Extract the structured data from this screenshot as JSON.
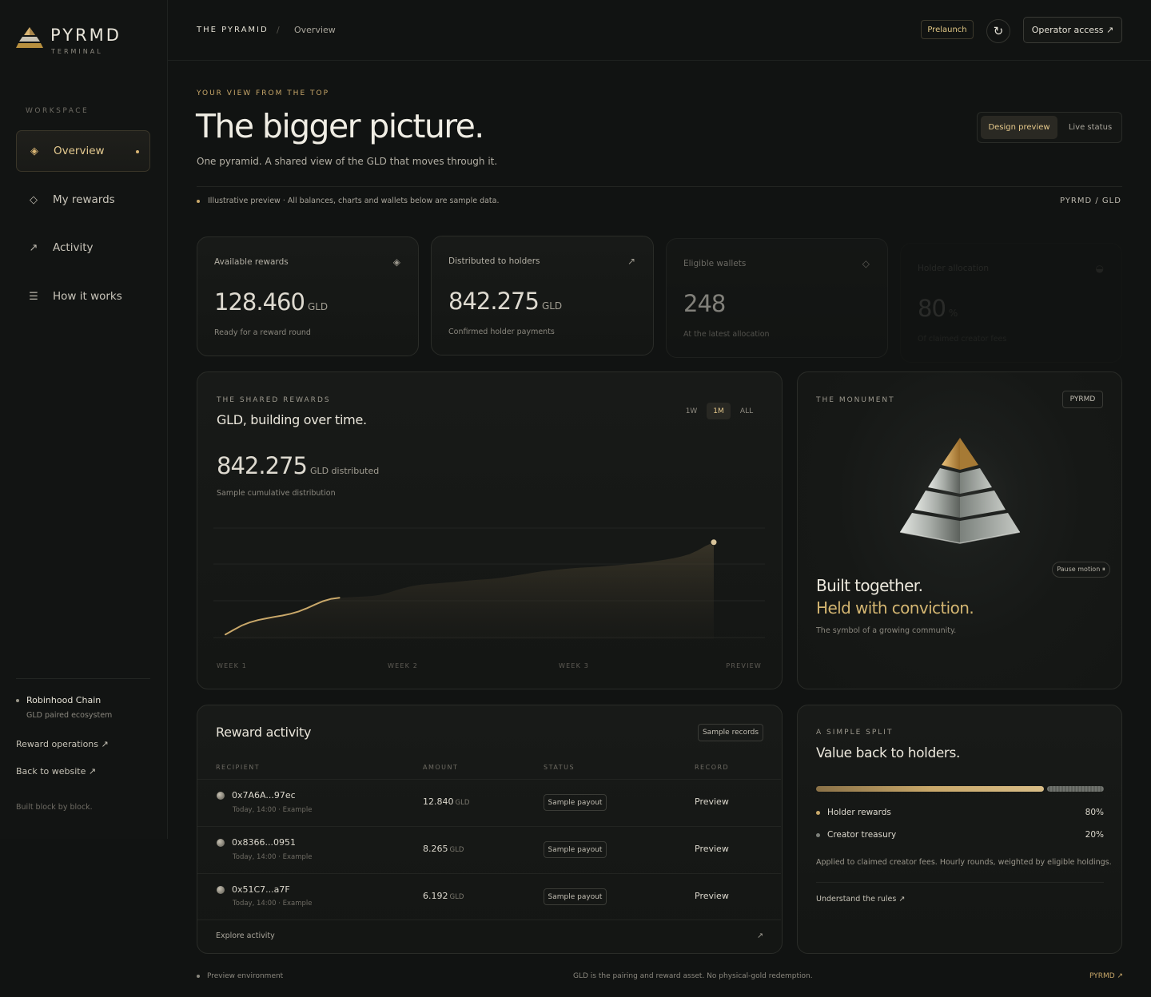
{
  "brand": {
    "name": "PYRMD",
    "sub": "TERMINAL"
  },
  "sidebar": {
    "section_label": "WORKSPACE",
    "items": [
      {
        "label": "Overview",
        "icon": "diamond-icon",
        "active": true
      },
      {
        "label": "My rewards",
        "icon": "diamond-outline-icon"
      },
      {
        "label": "Activity",
        "icon": "arrow-up-right-icon"
      },
      {
        "label": "How it works",
        "icon": "menu-lines-icon"
      }
    ],
    "chain": {
      "name": "Robinhood Chain",
      "sub": "GLD paired ecosystem"
    },
    "links": [
      "Reward operations ↗",
      "Back to website ↗"
    ],
    "footer": "Built block by block."
  },
  "topbar": {
    "crumb_1": "THE PYRAMID",
    "crumb_sep": "/",
    "crumb_2": "Overview",
    "prelaunch": "Prelaunch",
    "refresh_icon": "↻",
    "operator": "Operator access ↗"
  },
  "hero": {
    "eyebrow": "YOUR VIEW FROM THE TOP",
    "title": "The bigger picture.",
    "lede": "One pyramid. A shared view of the GLD that moves through it.",
    "toggle": [
      "Design preview",
      "Live status"
    ],
    "notice": "Illustrative preview · All balances, charts and wallets below are sample data.",
    "pair": "PYRMD / GLD"
  },
  "stats": [
    {
      "label": "Available rewards",
      "value": "128.460",
      "unit": "GLD",
      "sub": "Ready for a reward round",
      "icon": "◈"
    },
    {
      "label": "Distributed to holders",
      "value": "842.275",
      "unit": "GLD",
      "sub": "Confirmed holder payments",
      "icon": "↗"
    },
    {
      "label": "Eligible wallets",
      "value": "248",
      "unit": "",
      "sub": "At the latest allocation",
      "icon": "◇"
    },
    {
      "label": "Holder allocation",
      "value": "80",
      "unit": "%",
      "sub": "Of claimed creator fees",
      "icon": "◒"
    }
  ],
  "chart": {
    "eyebrow": "THE SHARED REWARDS",
    "title": "GLD, building over time.",
    "ranges": [
      "1W",
      "1M",
      "ALL"
    ],
    "big_value": "842.275",
    "big_unit": "GLD distributed",
    "sub": "Sample cumulative distribution"
  },
  "chart_data": {
    "type": "area",
    "x_labels": [
      "WEEK 1",
      "WEEK 2",
      "WEEK 3",
      "PREVIEW"
    ],
    "x": [
      0,
      0.5,
      1,
      1.5,
      2,
      2.5,
      3,
      3.5,
      4,
      4.5,
      5,
      5.5,
      6,
      6.5,
      7,
      7.5,
      8,
      8.5,
      9,
      9.5,
      10,
      10.5,
      11,
      11.5,
      12,
      12.5,
      13,
      13.5,
      14,
      14.5,
      15,
      15.5,
      16,
      16.5,
      17,
      17.5,
      18,
      18.5,
      19,
      19.5,
      20,
      20.5,
      21,
      21.5,
      22,
      22.5,
      23,
      23.5,
      24,
      24.5,
      25,
      25.5,
      26,
      26.5,
      27,
      27.5,
      28,
      28.5,
      29,
      29.5,
      30
    ],
    "values": [
      40,
      80,
      118,
      145,
      165,
      180,
      193,
      205,
      220,
      240,
      268,
      300,
      330,
      350,
      360,
      363,
      367,
      370,
      374,
      385,
      403,
      425,
      445,
      462,
      473,
      480,
      485,
      490,
      496,
      503,
      510,
      516,
      520,
      526,
      535,
      545,
      556,
      568,
      580,
      590,
      598,
      605,
      612,
      618,
      622,
      626,
      630,
      636,
      642,
      648,
      655,
      662,
      670,
      680,
      690,
      702,
      718,
      738,
      770,
      810,
      842
    ],
    "highlight_until_index": 14,
    "ylim": [
      0,
      1000
    ],
    "grid": true,
    "line_color": "#c9a86a"
  },
  "monument": {
    "eyebrow": "THE MONUMENT",
    "tag": "PYRMD",
    "pause": "Pause motion ⏸",
    "line_1": "Built together.",
    "line_2": "Held with conviction.",
    "sub": "The symbol of a growing community."
  },
  "activity": {
    "title": "Reward activity",
    "tag": "Sample records",
    "headers": [
      "RECIPIENT",
      "AMOUNT",
      "STATUS",
      "RECORD"
    ],
    "rows": [
      {
        "address": "0x7A6A...97ec",
        "meta": "Today, 14:00 · Example",
        "amount": "12.840",
        "unit": "GLD",
        "status": "Sample payout",
        "record": "Preview"
      },
      {
        "address": "0x8366...0951",
        "meta": "Today, 14:00 · Example",
        "amount": "8.265",
        "unit": "GLD",
        "status": "Sample payout",
        "record": "Preview"
      },
      {
        "address": "0x51C7...a7F",
        "meta": "Today, 14:00 · Example",
        "amount": "6.192",
        "unit": "GLD",
        "status": "Sample payout",
        "record": "Preview"
      }
    ],
    "explore": "Explore activity",
    "explore_icon": "↗"
  },
  "split": {
    "eyebrow": "A SIMPLE SPLIT",
    "title": "Value back to holders.",
    "items": [
      {
        "label": "Holder rewards",
        "value": "80%",
        "share": 0.8,
        "color": "#c9a86a"
      },
      {
        "label": "Creator treasury",
        "value": "20%",
        "share": 0.2,
        "color": "#7d807a"
      }
    ],
    "note": "Applied to claimed creator fees. Hourly rounds, weighted by eligible holdings.",
    "link": "Understand the rules ↗"
  },
  "footer": {
    "left": "Preview environment",
    "mid": "GLD is the pairing and reward asset. No physical-gold redemption.",
    "right": "PYRMD ↗"
  }
}
